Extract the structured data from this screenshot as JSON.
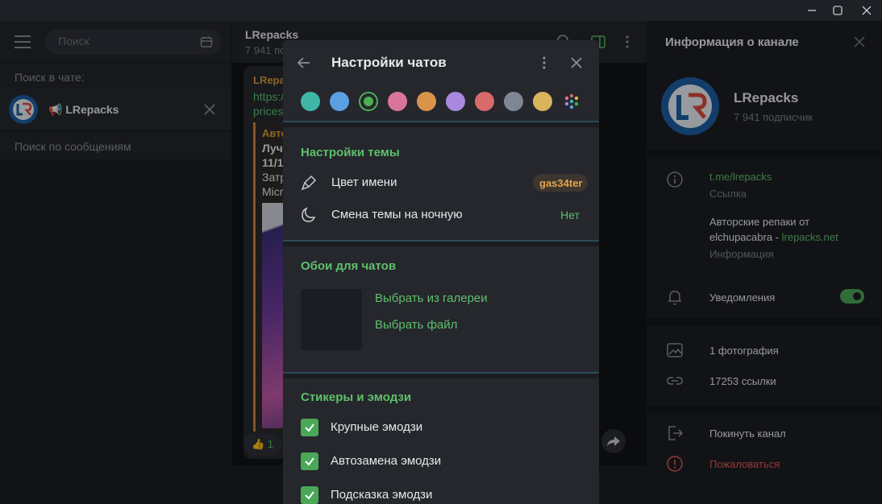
{
  "window": {
    "controls": [
      "minimize-icon",
      "maximize-icon",
      "close-icon"
    ]
  },
  "left_panel": {
    "search_placeholder": "Поиск",
    "search_in_chat_label": "Поиск в чате:",
    "chat_name": "📢 LRepacks",
    "search_messages_placeholder": "Поиск по сообщениям"
  },
  "chat": {
    "title": "LRepacks",
    "subtitle": "7 941 по",
    "bubble": {
      "author": "LRepa",
      "link1": "https:/",
      "link2": "prices.",
      "quote_title": "Авто",
      "quote_line1": "Лучш",
      "quote_line2": "11/10",
      "quote_line3": "Затр",
      "quote_line4": "Micr"
    },
    "reaction": "👍 1"
  },
  "info_panel": {
    "title": "Информация о канале",
    "channel_name": "LRepacks",
    "subscribers": "7 941 подписчик",
    "link": "t.me/lrepacks",
    "link_caption": "Ссылка",
    "description_line1": "Авторские репаки от",
    "description_line2_prefix": "elchupacabra - ",
    "description_line2_link": "lrepacks.net",
    "description_caption": "Информация",
    "notifications_label": "Уведомления",
    "notifications_on": true,
    "photos": "1 фотография",
    "links": "17253 ссылки",
    "leave": "Покинуть канал",
    "report": "Пожаловаться"
  },
  "modal": {
    "title": "Настройки чатов",
    "swatch_colors": [
      "#3fb6a8",
      "#5a9fe0",
      "#4caf50",
      "#d9749a",
      "#d9944a",
      "#a889de",
      "#d96a6a",
      "#7f8795",
      "#d9b45a"
    ],
    "selected_swatch_index": 2,
    "theme_section": "Настройки темы",
    "name_color_label": "Цвет имени",
    "name_color_value": "gas34ter",
    "night_mode_label": "Смена темы на ночную",
    "night_mode_value": "Нет",
    "wallpaper_section": "Обои для чатов",
    "choose_gallery": "Выбрать из галереи",
    "choose_file": "Выбрать файл",
    "stickers_section": "Стикеры и эмодзи",
    "checkboxes": [
      {
        "label": "Крупные эмодзи",
        "checked": true
      },
      {
        "label": "Автозамена эмодзи",
        "checked": true
      },
      {
        "label": "Подсказка эмодзи",
        "checked": true
      }
    ]
  },
  "colors": {
    "accent": "#5fbf6a",
    "danger": "#e05a5a",
    "badge_text": "#e3a44d"
  }
}
